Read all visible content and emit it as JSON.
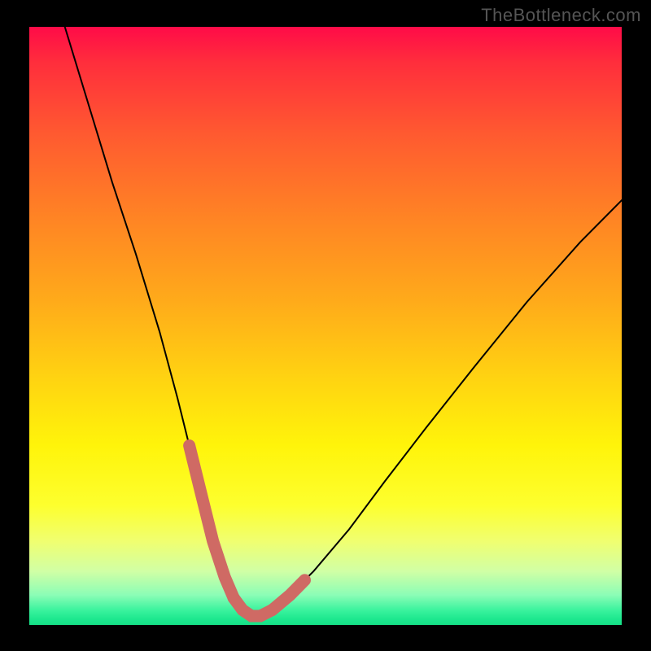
{
  "watermark": "TheBottleneck.com",
  "chart_data": {
    "type": "line",
    "title": "",
    "xlabel": "",
    "ylabel": "",
    "x_range": [
      0,
      100
    ],
    "y_range": [
      0,
      100
    ],
    "series": [
      {
        "name": "bottleneck-curve",
        "x": [
          6,
          10,
          14,
          18,
          22,
          25,
          27,
          29,
          31,
          33,
          34.5,
          36,
          37.5,
          39,
          41,
          44,
          48,
          54,
          60,
          67,
          75,
          84,
          93,
          100
        ],
        "y": [
          100,
          87,
          74,
          62,
          49,
          38,
          30,
          22,
          14,
          8,
          4.5,
          2.5,
          1.5,
          1.5,
          2.5,
          5,
          9,
          16,
          24,
          33,
          43,
          54,
          64,
          71
        ]
      }
    ],
    "highlighted_segments": [
      {
        "name": "left-descent-highlight",
        "x": [
          27,
          29,
          31,
          33,
          34.5
        ],
        "y": [
          30,
          22,
          14,
          8,
          4.5
        ]
      },
      {
        "name": "trough-highlight",
        "x": [
          34.5,
          36,
          37.5,
          39,
          41
        ],
        "y": [
          4.5,
          2.5,
          1.5,
          1.5,
          2.5
        ]
      },
      {
        "name": "right-ascent-highlight",
        "x": [
          41,
          44,
          46.5
        ],
        "y": [
          2.5,
          5,
          7.5
        ]
      }
    ],
    "colors": {
      "background_gradient_top": "#ff0b48",
      "background_gradient_bottom": "#15e086",
      "curve": "#000000",
      "highlight": "#cf6a64",
      "frame": "#000000"
    }
  }
}
